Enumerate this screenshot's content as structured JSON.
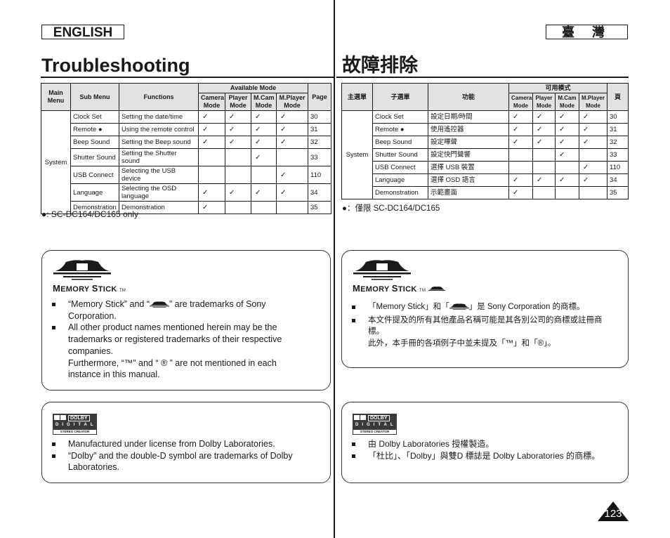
{
  "header": {
    "lang_en": "ENGLISH",
    "lang_tw": "臺 灣",
    "title_en": "Troubleshooting",
    "title_tw": "故障排除"
  },
  "table_en": {
    "headers": {
      "main_menu": "Main Menu",
      "sub_menu": "Sub Menu",
      "functions": "Functions",
      "available_mode": "Available Mode",
      "modes": [
        "Camera Mode",
        "Player Mode",
        "M.Cam Mode",
        "M.Player Mode"
      ],
      "page": "Page"
    },
    "main_menu_value": "System",
    "rows": [
      {
        "sub": "Clock Set",
        "func": "Setting the date/time",
        "m": [
          "✓",
          "✓",
          "✓",
          "✓"
        ],
        "page": "30"
      },
      {
        "sub": "Remote ●",
        "func": "Using the remote control",
        "m": [
          "✓",
          "✓",
          "✓",
          "✓"
        ],
        "page": "31"
      },
      {
        "sub": "Beep Sound",
        "func": "Setting the Beep sound",
        "m": [
          "✓",
          "✓",
          "✓",
          "✓"
        ],
        "page": "32"
      },
      {
        "sub": "Shutter Sound",
        "func": "Setting the Shutter sound",
        "m": [
          "",
          "",
          "✓",
          ""
        ],
        "page": "33"
      },
      {
        "sub": "USB Connect",
        "func": "Selecting the USB device",
        "m": [
          "",
          "",
          "",
          "✓"
        ],
        "page": "110"
      },
      {
        "sub": "Language",
        "func": "Selecting the OSD language",
        "m": [
          "✓",
          "✓",
          "✓",
          "✓"
        ],
        "page": "34"
      },
      {
        "sub": "Demonstration",
        "func": "Demonstration",
        "m": [
          "✓",
          "",
          "",
          ""
        ],
        "page": "35"
      }
    ],
    "note": "●: SC-DC164/DC165 only"
  },
  "table_tw": {
    "headers": {
      "main_menu": "主選單",
      "sub_menu": "子選單",
      "functions": "功能",
      "available_mode": "可用模式",
      "modes": [
        "Camera Mode",
        "Player Mode",
        "M.Cam Mode",
        "M.Player Mode"
      ],
      "page": "頁"
    },
    "main_menu_value": "System",
    "rows": [
      {
        "sub": "Clock Set",
        "func": "設定日期/時間",
        "m": [
          "✓",
          "✓",
          "✓",
          "✓"
        ],
        "page": "30"
      },
      {
        "sub": "Remote ●",
        "func": "使用遙控器",
        "m": [
          "✓",
          "✓",
          "✓",
          "✓"
        ],
        "page": "31"
      },
      {
        "sub": "Beep Sound",
        "func": "設定嗶聲",
        "m": [
          "✓",
          "✓",
          "✓",
          "✓"
        ],
        "page": "32"
      },
      {
        "sub": "Shutter Sound",
        "func": "設定快門聲響",
        "m": [
          "",
          "",
          "✓",
          ""
        ],
        "page": "33"
      },
      {
        "sub": "USB Connect",
        "func": "選擇 USB 裝置",
        "m": [
          "",
          "",
          "",
          "✓"
        ],
        "page": "110"
      },
      {
        "sub": "Language",
        "func": "選擇 OSD 語言",
        "m": [
          "✓",
          "✓",
          "✓",
          "✓"
        ],
        "page": "34"
      },
      {
        "sub": "Demonstration",
        "func": "示範畫面",
        "m": [
          "✓",
          "",
          "",
          ""
        ],
        "page": "35"
      }
    ],
    "note": "●：僅限 SC-DC164/DC165"
  },
  "memory_stick_en": {
    "logo_text_cap1": "M",
    "logo_text_rest1": "EMORY ",
    "logo_text_cap2": "S",
    "logo_text_rest2": "TICK",
    "logo_tm": "TM",
    "bullets": [
      {
        "pre": "“Memory Stick” and “",
        "post": "” are trademarks of Sony Corporation."
      },
      {
        "text": "All other product names mentioned herein may be the trademarks or registered trademarks of their respective companies.",
        "extra": "Furthermore, “™” and “ ® ” are not mentioned in each instance in this manual."
      }
    ]
  },
  "memory_stick_tw": {
    "bullets": [
      {
        "pre": "「Memory Stick」和「",
        "post": "」是 Sony Corporation 的商標。"
      },
      {
        "text": "本文件提及的所有其他產品名稱可能是其各別公司的商標或註冊商標。",
        "extra": "此外，本手冊的各項例子中並未提及「™」和「®」。"
      }
    ]
  },
  "dolby_logo": {
    "word": "DOLBY",
    "digital": "DIGITAL",
    "stereo": "STEREO CREATOR"
  },
  "dolby_en": {
    "bullets": [
      "Manufactured under license from Dolby Laboratories.",
      "“Dolby” and the double-D symbol are trademarks of Dolby Laboratories."
    ]
  },
  "dolby_tw": {
    "bullets": [
      "由 Dolby Laboratories 授權製造。",
      "「杜比」、「Dolby」與雙D 標誌是 Dolby Laboratories 的商標。"
    ]
  },
  "page_number": "123"
}
